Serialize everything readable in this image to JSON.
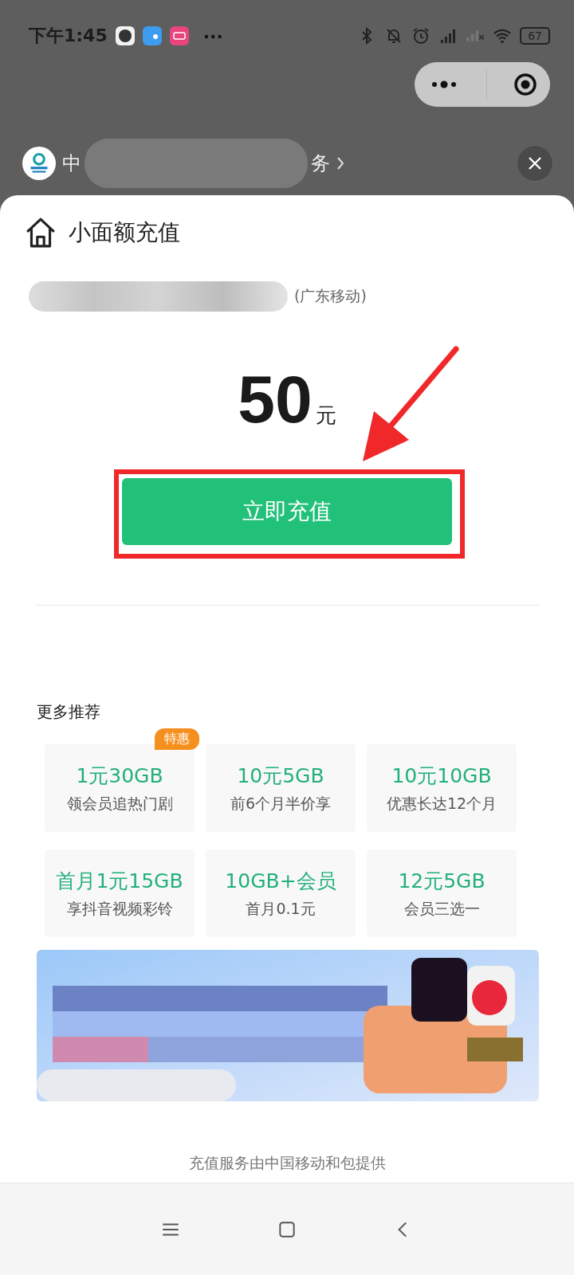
{
  "status_bar": {
    "time": "下午1:45",
    "more": "···",
    "battery": "67"
  },
  "mini_program": {
    "name_start": "中",
    "name_end": "务"
  },
  "page": {
    "title": "小面额充值",
    "carrier": "(广东移动)",
    "amount": "50",
    "unit": "元",
    "button": "立即充值"
  },
  "recommend": {
    "title": "更多推荐",
    "cards": [
      {
        "title": "1元30GB",
        "subtitle": "领会员追热门剧",
        "badge": "特惠"
      },
      {
        "title": "10元5GB",
        "subtitle": "前6个月半价享"
      },
      {
        "title": "10元10GB",
        "subtitle": "优惠长达12个月"
      },
      {
        "title": "首月1元15GB",
        "subtitle": "享抖音视频彩铃"
      },
      {
        "title": "10GB+会员",
        "subtitle": "首月0.1元"
      },
      {
        "title": "12元5GB",
        "subtitle": "会员三选一"
      }
    ]
  },
  "footer": "充值服务由中国移动和包提供"
}
